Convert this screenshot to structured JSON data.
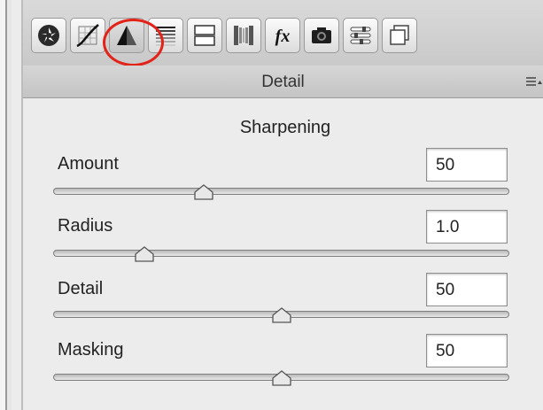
{
  "toolbar": {
    "tools": [
      {
        "icon": "aperture-icon"
      },
      {
        "icon": "tone-curve-icon"
      },
      {
        "icon": "detail-triangle-icon",
        "active": true,
        "highlighted": true
      },
      {
        "icon": "hsl-grayscale-icon"
      },
      {
        "icon": "split-toning-icon"
      },
      {
        "icon": "lens-corrections-icon"
      },
      {
        "icon": "effects-fx-icon",
        "label": "fx"
      },
      {
        "icon": "camera-calibration-icon"
      },
      {
        "icon": "presets-sliders-icon"
      },
      {
        "icon": "snapshots-icon"
      }
    ],
    "highlight_color": "#e2231a"
  },
  "panel": {
    "title": "Detail",
    "menu_icon": "panel-menu-icon"
  },
  "section": {
    "title": "Sharpening"
  },
  "sliders": [
    {
      "label": "Amount",
      "value": "50",
      "level": 0.33
    },
    {
      "label": "Radius",
      "value": "1.0",
      "level": 0.2
    },
    {
      "label": "Detail",
      "value": "50",
      "level": 0.5
    },
    {
      "label": "Masking",
      "value": "50",
      "level": 0.5
    }
  ]
}
